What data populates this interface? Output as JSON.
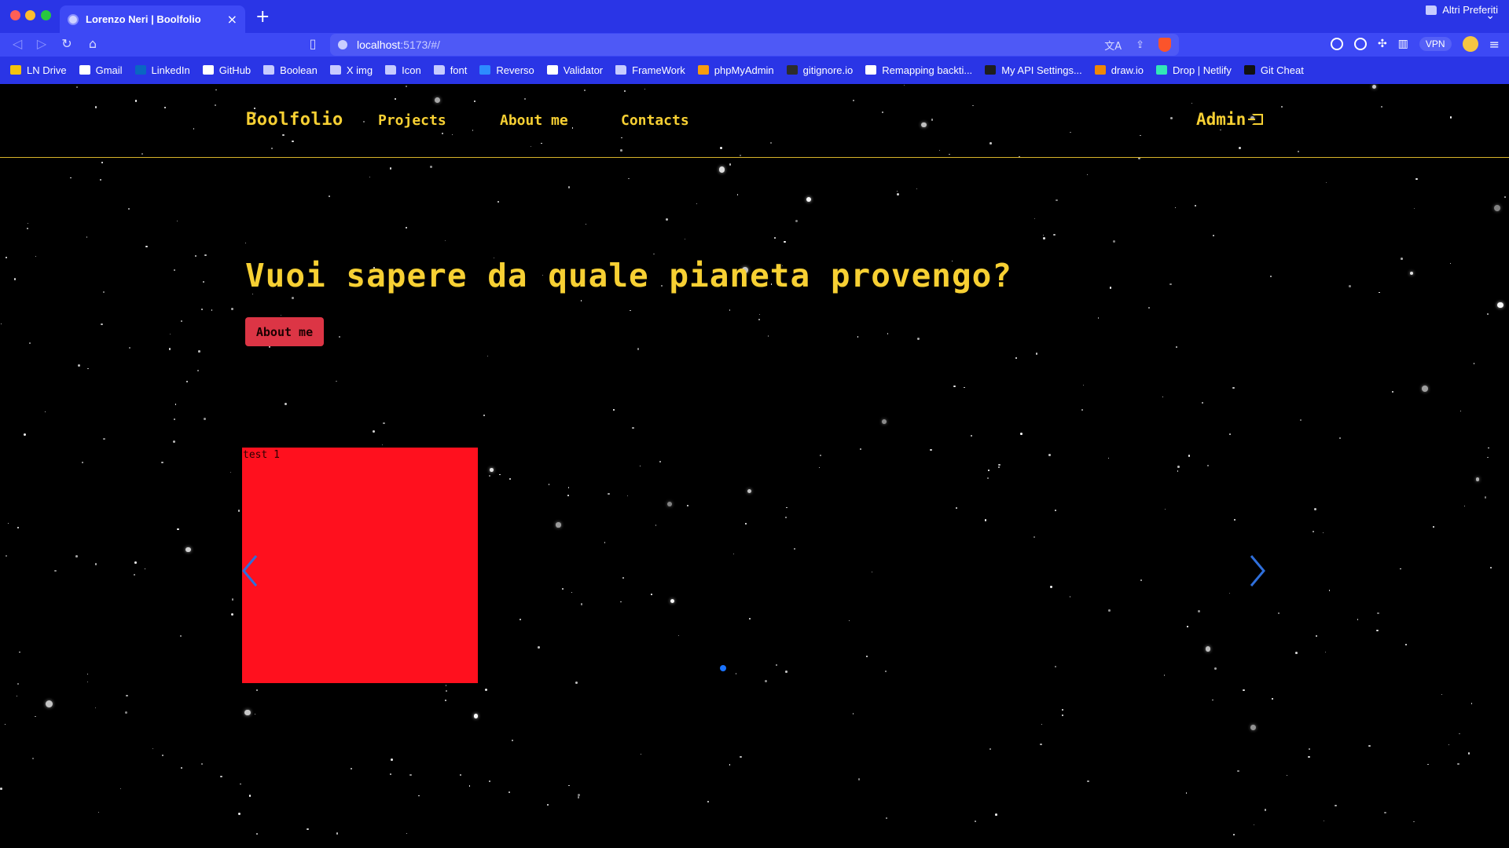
{
  "browser": {
    "tab_title": "Lorenzo Neri | Boolfolio",
    "url_host": "localhost",
    "url_path": ":5173/#/",
    "vpn_label": "VPN",
    "bookmarks": [
      {
        "label": "LN Drive",
        "icon": "drive-icon"
      },
      {
        "label": "Gmail",
        "icon": "gmail-icon"
      },
      {
        "label": "LinkedIn",
        "icon": "linkedin-icon"
      },
      {
        "label": "GitHub",
        "icon": "github-icon"
      },
      {
        "label": "Boolean",
        "icon": "folder-icon"
      },
      {
        "label": "X img",
        "icon": "folder-icon"
      },
      {
        "label": "Icon",
        "icon": "folder-icon"
      },
      {
        "label": "font",
        "icon": "folder-icon"
      },
      {
        "label": "Reverso",
        "icon": "reverso-icon"
      },
      {
        "label": "Validator",
        "icon": "w3c-icon"
      },
      {
        "label": "FrameWork",
        "icon": "folder-icon"
      },
      {
        "label": "phpMyAdmin",
        "icon": "phpmyadmin-icon"
      },
      {
        "label": "gitignore.io",
        "icon": "gitignore-icon"
      },
      {
        "label": "Remapping backti...",
        "icon": "medium-icon"
      },
      {
        "label": "My API Settings...",
        "icon": "api-icon"
      },
      {
        "label": "draw.io",
        "icon": "drawio-icon"
      },
      {
        "label": "Drop | Netlify",
        "icon": "netlify-icon"
      },
      {
        "label": "Git Cheat",
        "icon": "gitcheat-icon"
      }
    ],
    "other_bookmarks": "Altri Preferiti"
  },
  "site": {
    "brand": "Boolfolio",
    "nav": {
      "projects": "Projects",
      "about": "About me",
      "contacts": "Contacts"
    },
    "admin": "Admin"
  },
  "hero": {
    "title": "Vuoi sapere da quale pianeta provengo?",
    "button": "About me"
  },
  "carousel": {
    "slide_caption": "test 1",
    "slide_color": "#ff101e",
    "indicator_color": "#1a73ff"
  },
  "colors": {
    "accent": "#f7d033",
    "chrome": "#2a35e6",
    "button": "#dc3545"
  }
}
